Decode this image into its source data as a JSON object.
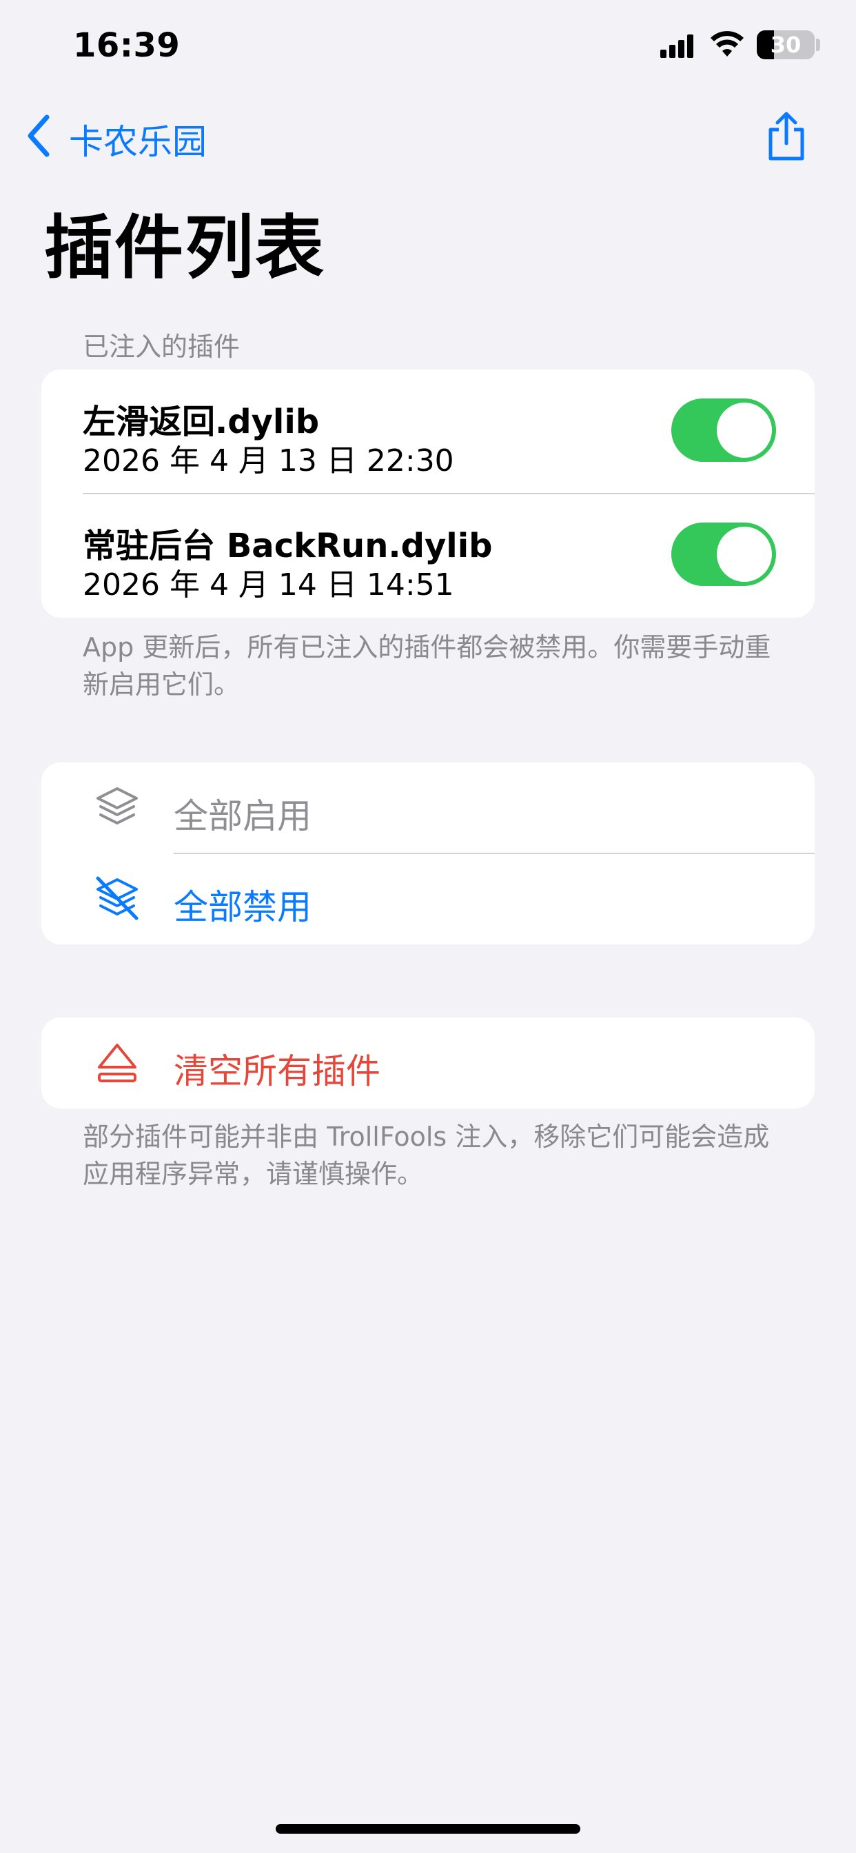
{
  "status_bar": {
    "time": "16:39",
    "battery_level": "30",
    "battery_fraction": 0.3
  },
  "nav": {
    "back_label": "卡农乐园",
    "share_icon": "share-icon"
  },
  "page": {
    "title": "插件列表"
  },
  "injected_section": {
    "header": "已注入的插件",
    "items": [
      {
        "name": "左滑返回.dylib",
        "date": "2026 年 4 月 13 日 22:30",
        "enabled": true
      },
      {
        "name": "常驻后台 BackRun.dylib",
        "date": "2026 年 4 月 14 日 14:51",
        "enabled": true
      }
    ],
    "footer": "App 更新后，所有已注入的插件都会被禁用。你需要手动重新启用它们。"
  },
  "bulk_actions": {
    "enable_all": "全部启用",
    "disable_all": "全部禁用"
  },
  "danger_section": {
    "clear_all": "清空所有插件",
    "footer": "部分插件可能并非由 TrollFools 注入，移除它们可能会造成应用程序异常，请谨慎操作。"
  },
  "colors": {
    "accent": "#0a7aff",
    "toggle_on": "#34c759",
    "destructive": "#e5483a",
    "disabled_text": "#8e8e93",
    "background": "#f2f2f7"
  }
}
